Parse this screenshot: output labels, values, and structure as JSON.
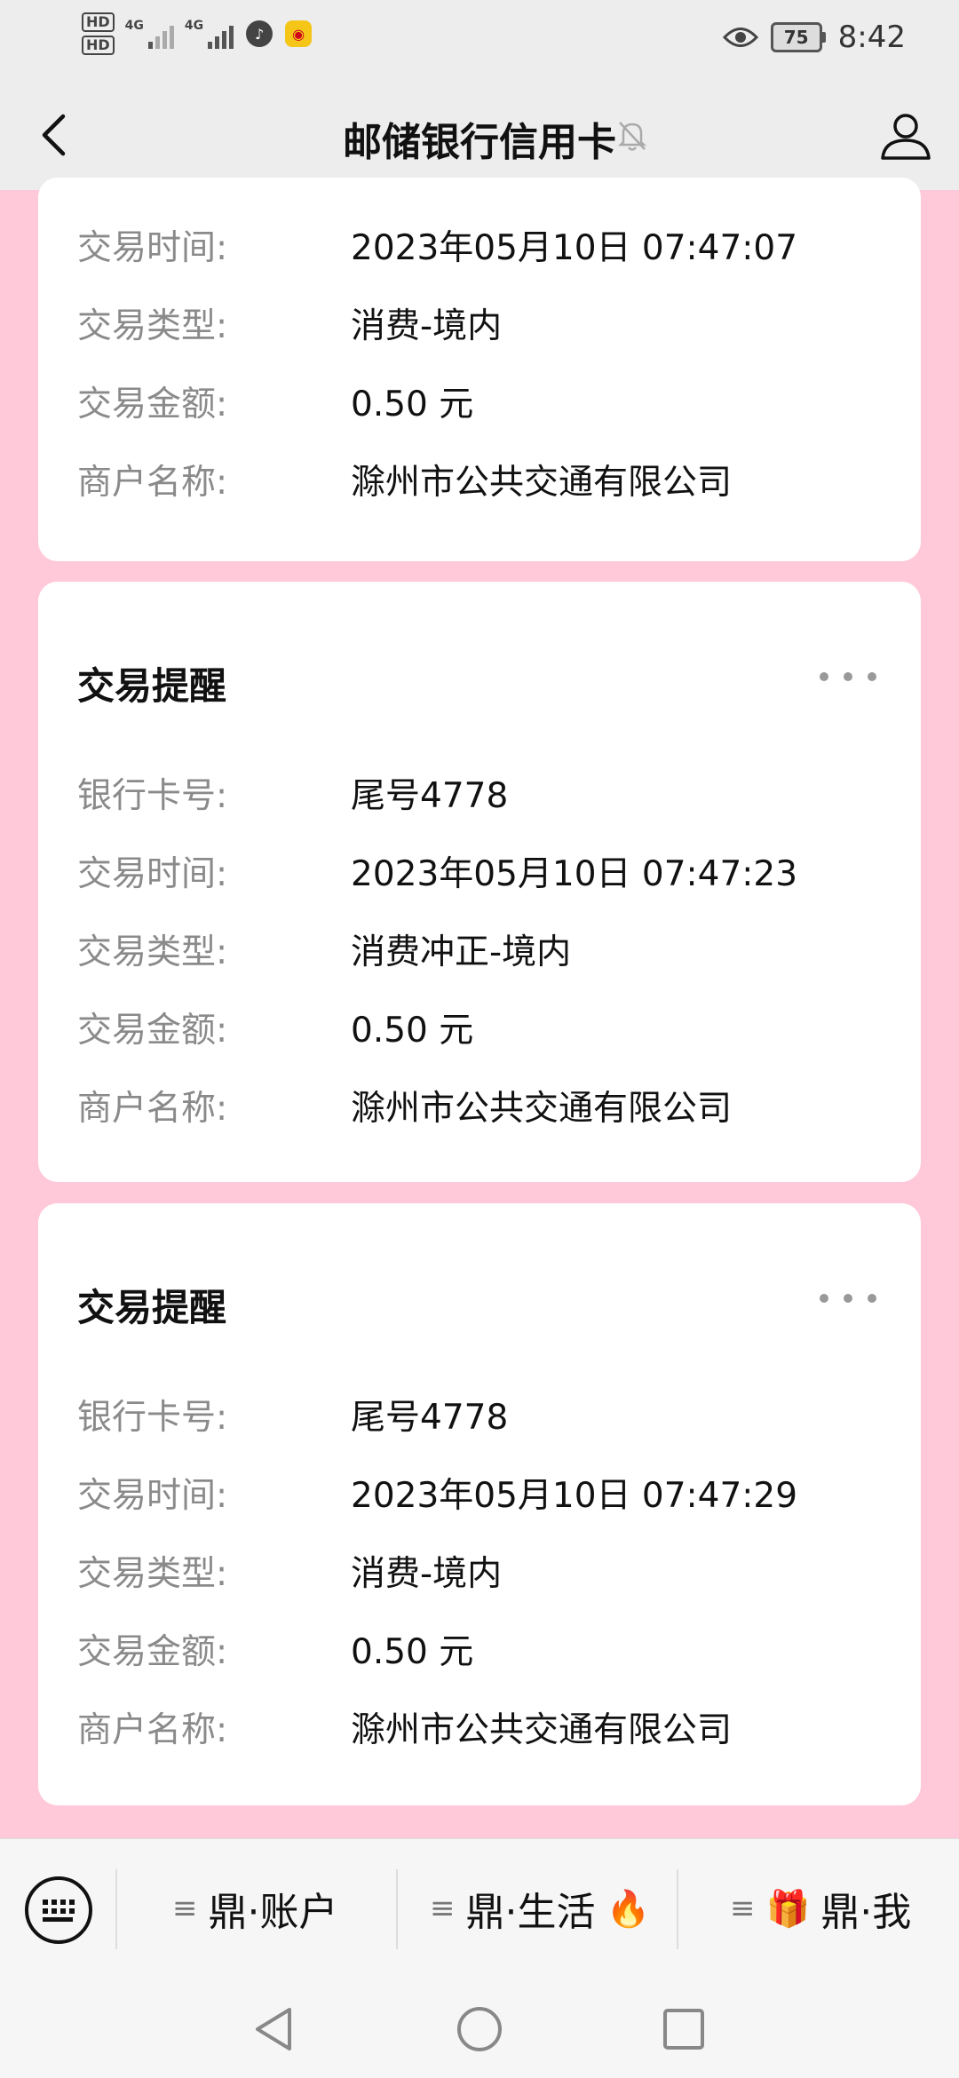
{
  "status_bar": {
    "hd1": "HD",
    "hd2": "HD",
    "signal1_label": "4G",
    "signal2_label": "4G",
    "battery": "75",
    "time": "8:42"
  },
  "header": {
    "title": "邮储银行信用卡"
  },
  "cards": [
    {
      "title": "",
      "rows": [
        {
          "label": "交易时间:",
          "value": "2023年05月10日 07:47:07"
        },
        {
          "label": "交易类型:",
          "value": "消费-境内"
        },
        {
          "label": "交易金额:",
          "value": "0.50 元"
        },
        {
          "label": "商户名称:",
          "value": "滁州市公共交通有限公司"
        }
      ]
    },
    {
      "title": "交易提醒",
      "rows": [
        {
          "label": "银行卡号:",
          "value": "尾号4778"
        },
        {
          "label": "交易时间:",
          "value": "2023年05月10日 07:47:23"
        },
        {
          "label": "交易类型:",
          "value": "消费冲正-境内"
        },
        {
          "label": "交易金额:",
          "value": "0.50 元"
        },
        {
          "label": "商户名称:",
          "value": "滁州市公共交通有限公司"
        }
      ]
    },
    {
      "title": "交易提醒",
      "rows": [
        {
          "label": "银行卡号:",
          "value": "尾号4778"
        },
        {
          "label": "交易时间:",
          "value": "2023年05月10日 07:47:29"
        },
        {
          "label": "交易类型:",
          "value": "消费-境内"
        },
        {
          "label": "交易金额:",
          "value": "0.50 元"
        },
        {
          "label": "商户名称:",
          "value": "滁州市公共交通有限公司"
        }
      ]
    }
  ],
  "bottom_menu": {
    "items": [
      {
        "label": "鼎·账户",
        "emoji_before": "",
        "emoji_after": ""
      },
      {
        "label": "鼎·生活",
        "emoji_before": "",
        "emoji_after": "🔥"
      },
      {
        "label": "鼎·我",
        "emoji_before": "🎁",
        "emoji_after": ""
      }
    ]
  },
  "colors": {
    "background": "#ffc9da",
    "bar_gray": "#ededed",
    "card": "#ffffff",
    "label_gray": "#8a8a8a"
  }
}
